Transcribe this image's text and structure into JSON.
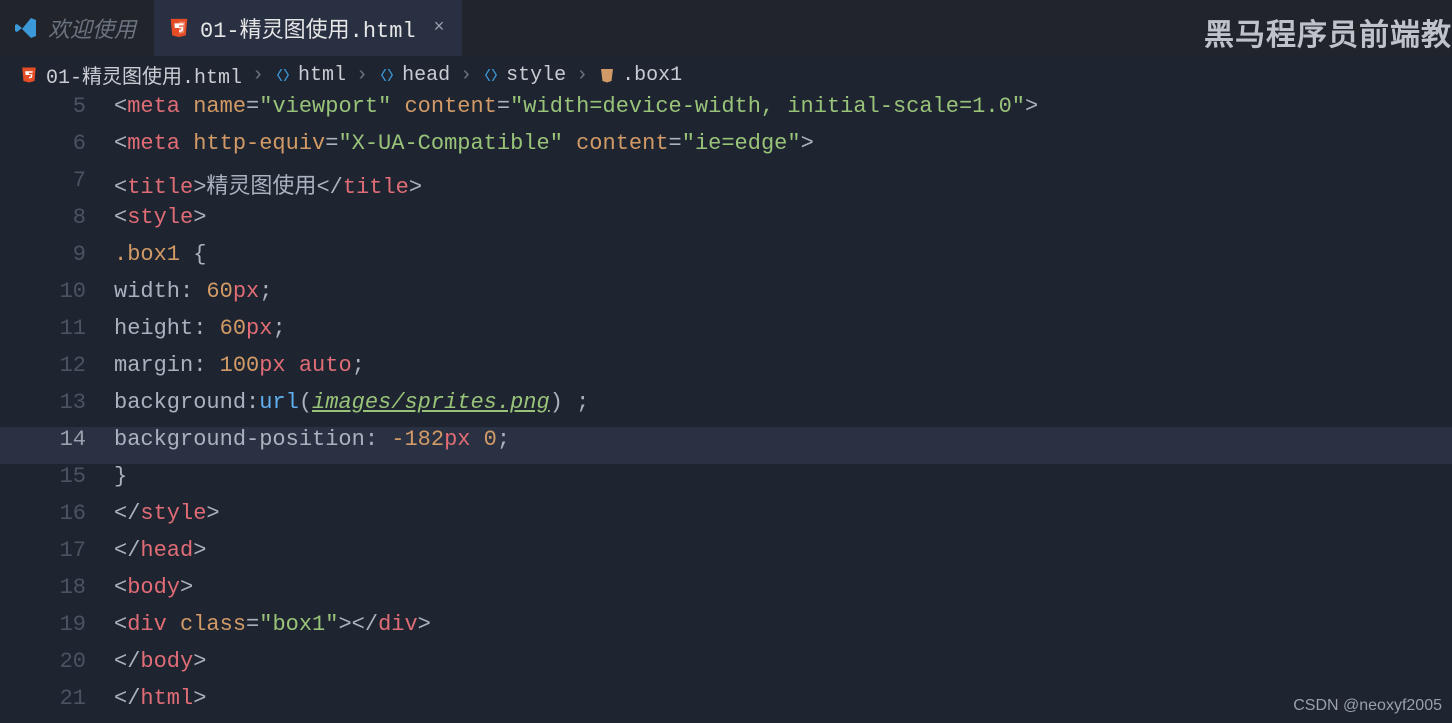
{
  "tabs": {
    "inactive": {
      "title": "欢迎使用"
    },
    "active": {
      "title": "01-精灵图使用.html",
      "close": "×"
    }
  },
  "watermarkTop": "黑马程序员前端教",
  "watermarkBottom": "CSDN @neoxyf2005",
  "breadcrumbs": {
    "file": "01-精灵图使用.html",
    "p1": "html",
    "p2": "head",
    "p3": "style",
    "p4": ".box1",
    "sep": "›"
  },
  "lineNumbers": [
    "5",
    "6",
    "7",
    "8",
    "9",
    "10",
    "11",
    "12",
    "13",
    "14",
    "15",
    "16",
    "17",
    "18",
    "19",
    "20",
    "21"
  ],
  "code": {
    "l5": {
      "tag": "meta",
      "attr1": "name",
      "val1": "viewport",
      "attr2": "content",
      "val2": "width=device-width, initial-scale=1.0"
    },
    "l6": {
      "tag": "meta",
      "attr1": "http-equiv",
      "val1": "X-UA-Compatible",
      "attr2": "content",
      "val2": "ie=edge"
    },
    "l7": {
      "tag": "title",
      "text": "精灵图使用"
    },
    "l8": {
      "tag": "style"
    },
    "l9": {
      "selector": ".box1"
    },
    "l10": {
      "prop": "width",
      "num": "60",
      "unit": "px"
    },
    "l11": {
      "prop": "height",
      "num": "60",
      "unit": "px"
    },
    "l12": {
      "prop": "margin",
      "num": "100",
      "unit": "px",
      "kw": "auto"
    },
    "l13": {
      "prop": "background",
      "func": "url",
      "arg": "images/sprites.png"
    },
    "l14": {
      "prop": "background-position",
      "num1": "-182",
      "unit1": "px",
      "num2": "0"
    },
    "l16": {
      "tag": "style"
    },
    "l17": {
      "tag": "head"
    },
    "l18": {
      "tag": "body"
    },
    "l19": {
      "tag": "div",
      "attr": "class",
      "val": "box1"
    },
    "l20": {
      "tag": "body"
    },
    "l21": {
      "tag": "html"
    }
  }
}
